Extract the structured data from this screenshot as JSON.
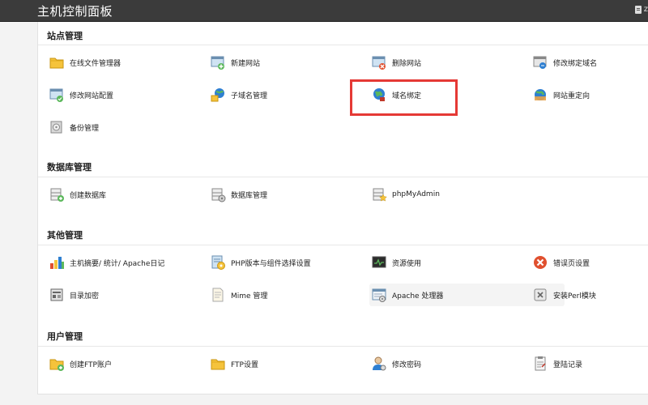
{
  "header": {
    "title": "主机控制面板"
  },
  "sections": [
    {
      "title": "站点管理",
      "items": [
        {
          "label": "在线文件管理器",
          "icon": "folder-icon"
        },
        {
          "label": "新建网站",
          "icon": "new-site-icon"
        },
        {
          "label": "删除网站",
          "icon": "delete-site-icon"
        },
        {
          "label": "修改绑定域名",
          "icon": "edit-domain-icon"
        },
        {
          "label": "修改网站配置",
          "icon": "site-config-icon"
        },
        {
          "label": "子域名管理",
          "icon": "subdomain-icon"
        },
        {
          "label": "域名绑定",
          "icon": "globe-icon"
        },
        {
          "label": "网站重定向",
          "icon": "redirect-icon"
        },
        {
          "label": "备份管理",
          "icon": "backup-icon"
        }
      ]
    },
    {
      "title": "数据库管理",
      "items": [
        {
          "label": "创建数据库",
          "icon": "create-db-icon"
        },
        {
          "label": "数据库管理",
          "icon": "db-manage-icon"
        },
        {
          "label": "phpMyAdmin",
          "icon": "phpmyadmin-icon"
        }
      ]
    },
    {
      "title": "其他管理",
      "items": [
        {
          "label": "主机摘要/ 统计/ Apache日记",
          "icon": "stats-chart-icon"
        },
        {
          "label": "PHP版本与组件选择设置",
          "icon": "php-settings-icon"
        },
        {
          "label": "资源使用",
          "icon": "monitor-icon"
        },
        {
          "label": "错误页设置",
          "icon": "error-icon"
        },
        {
          "label": "目录加密",
          "icon": "lock-dir-icon"
        },
        {
          "label": "Mime 管理",
          "icon": "mime-doc-icon"
        },
        {
          "label": "Apache 处理器",
          "icon": "apache-window-icon"
        },
        {
          "label": "安装Perl模块",
          "icon": "perl-module-icon"
        }
      ]
    },
    {
      "title": "用户管理",
      "items": [
        {
          "label": "创建FTP账户",
          "icon": "ftp-add-folder-icon"
        },
        {
          "label": "FTP设置",
          "icon": "ftp-folder-icon"
        },
        {
          "label": "修改密码",
          "icon": "user-password-icon"
        },
        {
          "label": "登陆记录",
          "icon": "login-log-icon"
        }
      ]
    }
  ],
  "colors": {
    "header_bg": "#3b3b3b",
    "highlight_box": "#e53935",
    "folder": "#f5c33b",
    "globe": "#2e7fd1",
    "error": "#e0502f",
    "add": "#5cb85c"
  }
}
